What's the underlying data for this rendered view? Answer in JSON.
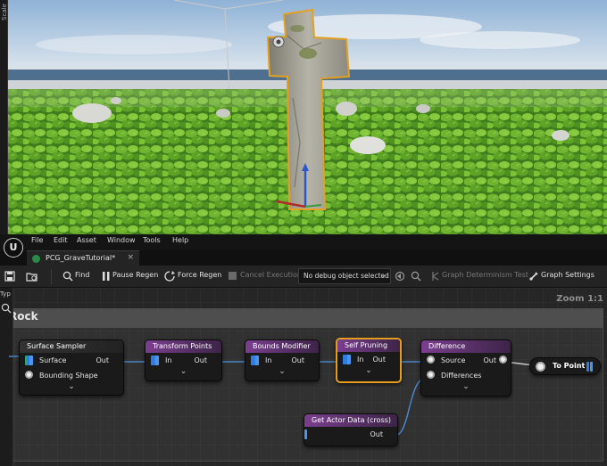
{
  "viewport": {
    "side_label": "Scale"
  },
  "menu": {
    "items": [
      "File",
      "Edit",
      "Asset",
      "Window",
      "Tools",
      "Help"
    ]
  },
  "tab": {
    "title": "PCG_GraveTutorial*",
    "close": "×"
  },
  "toolbar": {
    "find": "Find",
    "pause_regen": "Pause Regen",
    "force_regen": "Force Regen",
    "cancel_execution": "Cancel Execution",
    "debug_object": "No debug object selected",
    "graph_determinism_test": "Graph Determinism Test",
    "graph_settings": "Graph Settings"
  },
  "graph": {
    "typ_label": "Typ",
    "zoom": "Zoom 1:1",
    "comment_title": "Rock",
    "nodes": {
      "surface_sampler": {
        "title": "Surface Sampler",
        "in1": "Surface",
        "in2": "Bounding Shape",
        "out": "Out"
      },
      "transform_points": {
        "title": "Transform Points",
        "in": "In",
        "out": "Out"
      },
      "bounds_modifier": {
        "title": "Bounds Modifier",
        "in": "In",
        "out": "Out"
      },
      "self_pruning": {
        "title": "Self Pruning",
        "in": "In",
        "out": "Out"
      },
      "difference": {
        "title": "Difference",
        "in1": "Source",
        "in2": "Differences",
        "out": "Out"
      },
      "get_actor_data": {
        "title": "Get Actor Data (cross)",
        "out": "Out"
      },
      "to_point": {
        "title": "To Point"
      }
    }
  },
  "colors": {
    "selection": "#e59d1e",
    "pin_blue": "#2f7fe0",
    "pin_green": "#2faa55",
    "wire": "#4a86c8"
  }
}
